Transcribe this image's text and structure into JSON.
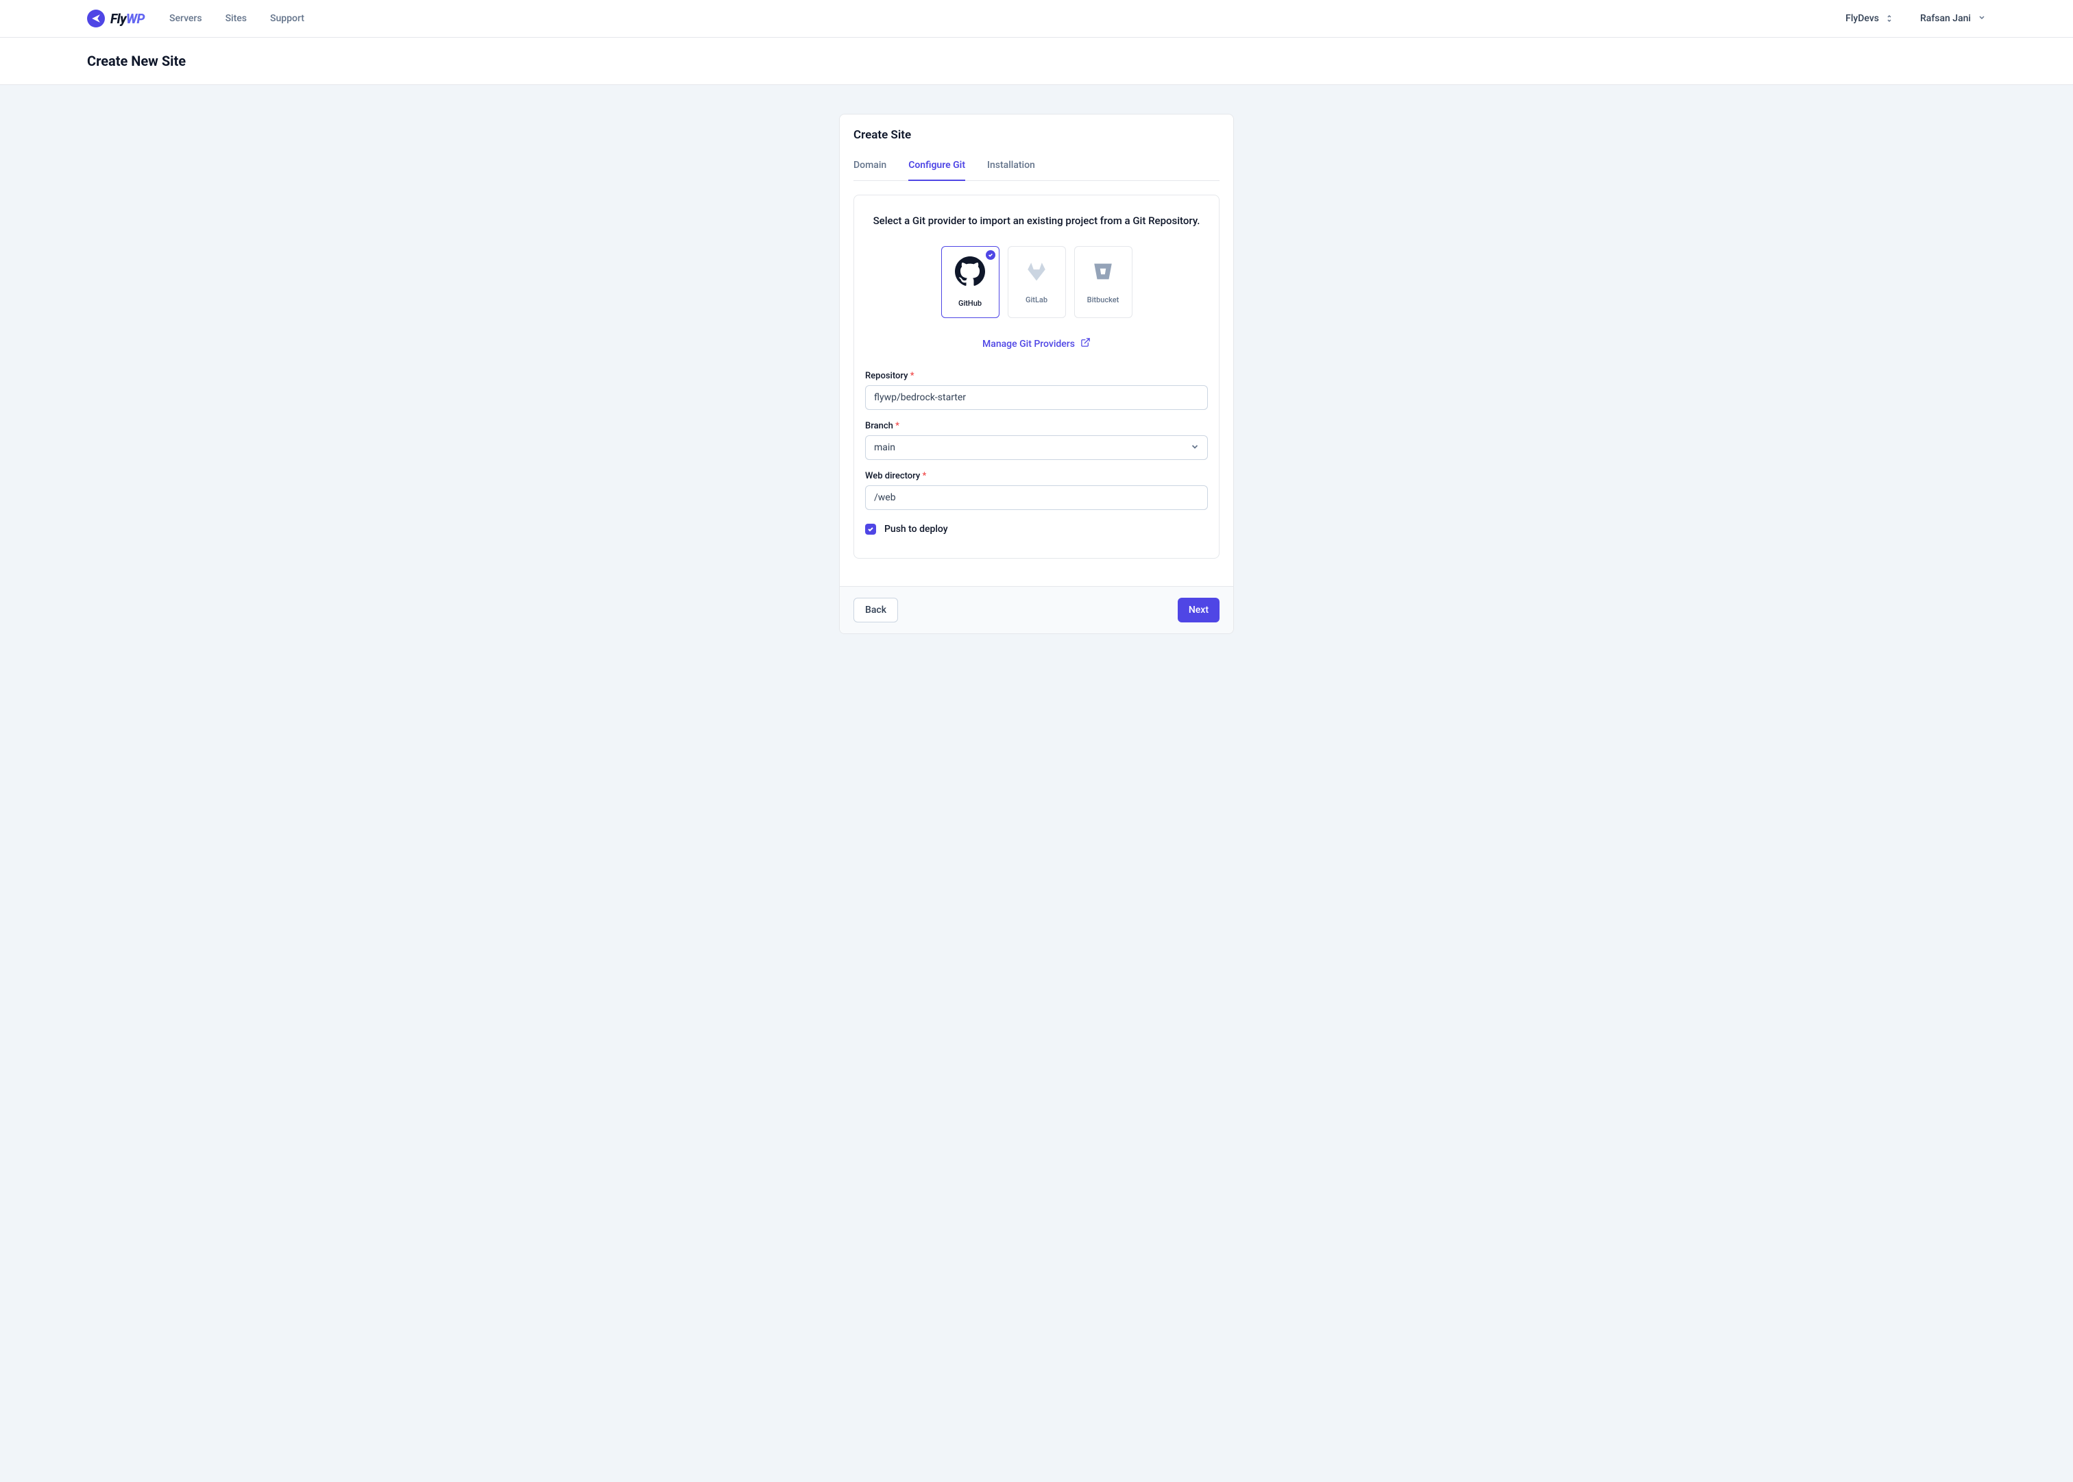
{
  "brand": {
    "name_left": "Fly",
    "name_right": "WP"
  },
  "nav": {
    "links": [
      "Servers",
      "Sites",
      "Support"
    ],
    "workspace": "FlyDevs",
    "user": "Rafsan Jani"
  },
  "page": {
    "title": "Create New Site"
  },
  "card": {
    "title": "Create Site",
    "tabs": [
      "Domain",
      "Configure Git",
      "Installation"
    ],
    "active_tab_index": 1
  },
  "git": {
    "description": "Select a Git provider to import an existing project from a Git Repository.",
    "providers": [
      {
        "id": "github",
        "label": "GitHub",
        "selected": true
      },
      {
        "id": "gitlab",
        "label": "GitLab",
        "selected": false
      },
      {
        "id": "bitbucket",
        "label": "Bitbucket",
        "selected": false
      }
    ],
    "manage_link": "Manage Git Providers"
  },
  "form": {
    "repository": {
      "label": "Repository",
      "value": "flywp/bedrock-starter"
    },
    "branch": {
      "label": "Branch",
      "value": "main"
    },
    "web_directory": {
      "label": "Web directory",
      "value": "/web"
    },
    "push_to_deploy": {
      "label": "Push to deploy",
      "checked": true
    }
  },
  "footer": {
    "back": "Back",
    "next": "Next"
  }
}
